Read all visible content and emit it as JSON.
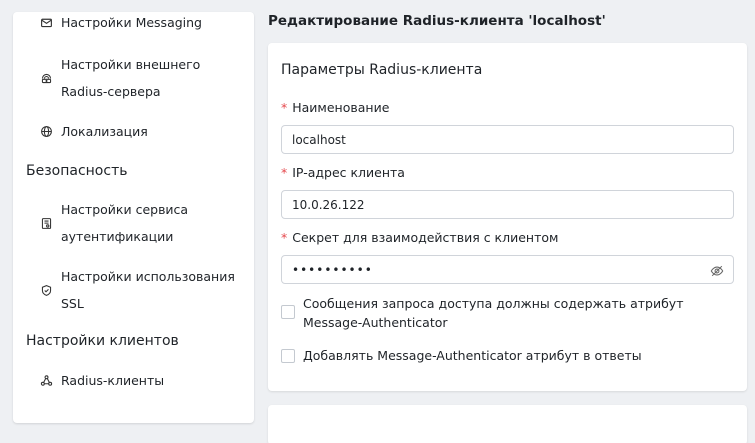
{
  "sidebar": {
    "items": [
      {
        "label": "Настройки Messaging"
      },
      {
        "label": "Настройки внешнего Radius-сервера"
      },
      {
        "label": "Локализация"
      },
      {
        "label": "Настройки сервиса аутентификации"
      },
      {
        "label": "Настройки использования SSL"
      },
      {
        "label": "Radius-клиенты"
      }
    ],
    "sections": [
      {
        "label": "Безопасность"
      },
      {
        "label": "Настройки клиентов"
      }
    ]
  },
  "page": {
    "title": "Редактирование Radius-клиента 'localhost'"
  },
  "form": {
    "card_title": "Параметры Radius-клиента",
    "required_mark": "*",
    "name": {
      "label": "Наименование",
      "value": "localhost"
    },
    "ip": {
      "label": "IP-адрес клиента",
      "value": "10.0.26.122"
    },
    "secret": {
      "label": "Секрет для взаимодействия с клиентом",
      "value": "••••••••••"
    },
    "checkboxes": [
      {
        "label": "Сообщения запроса доступа должны содержать атрибут Message-Authenticator",
        "checked": false
      },
      {
        "label": "Добавлять Message-Authenticator атрибут в ответы",
        "checked": false
      }
    ]
  },
  "icons": {
    "item0": "mail-icon",
    "item1": "radius-server-icon",
    "item2": "globe-icon",
    "item3": "auth-service-icon",
    "item4": "shield-icon",
    "item5": "network-icon",
    "eye": "eye-slash-icon"
  },
  "colors": {
    "required": "#e5484d",
    "background": "#eef0f3",
    "card": "#ffffff"
  }
}
